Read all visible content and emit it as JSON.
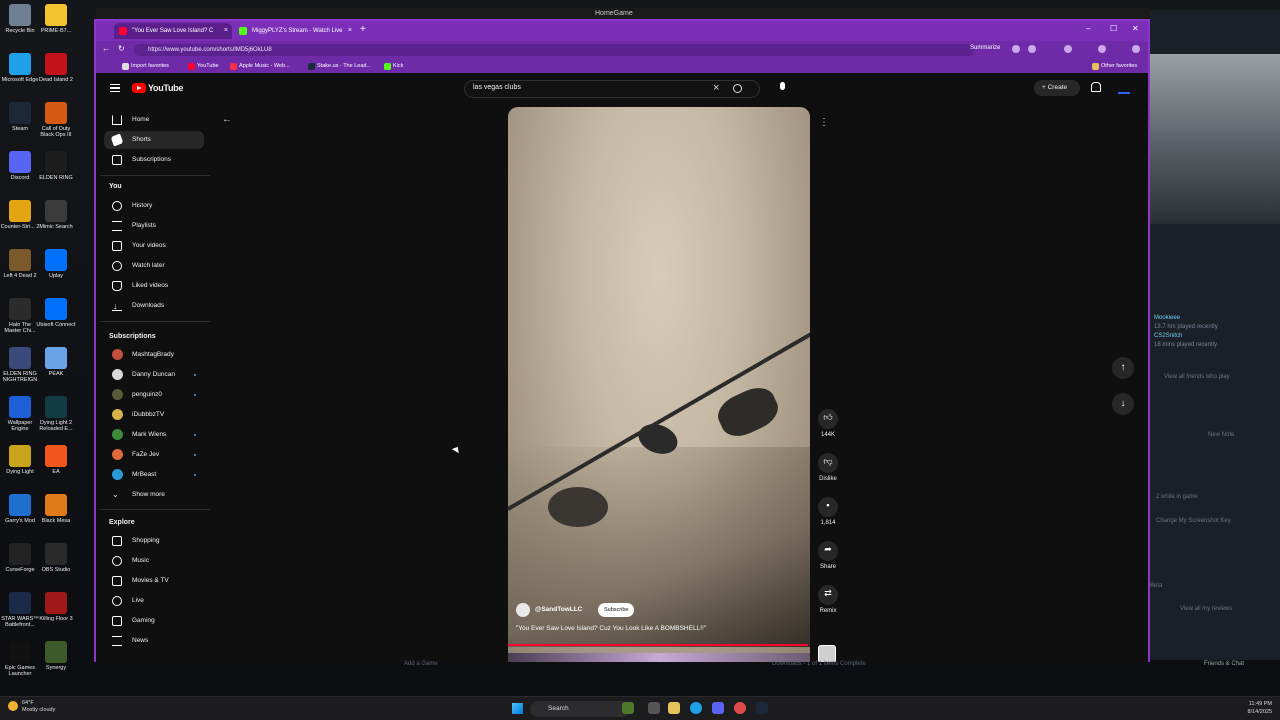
{
  "desktop": {
    "icons_col1": [
      {
        "label": "Recycle Bin",
        "color": "#6f7f93"
      },
      {
        "label": "Microsoft Edge",
        "color": "#1fa0e8"
      },
      {
        "label": "Steam",
        "color": "#1b2838"
      },
      {
        "label": "Discord",
        "color": "#5865f2"
      },
      {
        "label": "Counter-Stri... 2",
        "color": "#e3a512"
      },
      {
        "label": "Left 4 Dead 2",
        "color": "#7a5a2a"
      },
      {
        "label": "Halo The Master Chi...",
        "color": "#2b2b2b"
      },
      {
        "label": "ELDEN RING NIGHTREIGN",
        "color": "#3a4a7a"
      },
      {
        "label": "Wallpaper Engine",
        "color": "#1d5fd6"
      },
      {
        "label": "Dying Light",
        "color": "#c8a31c"
      },
      {
        "label": "Garry's Mod",
        "color": "#1f6fd1"
      },
      {
        "label": "CurseForge",
        "color": "#222222"
      },
      {
        "label": "STAR WARS™ Battlefront...",
        "color": "#1c2a4a"
      },
      {
        "label": "Epic Games Launcher",
        "color": "#111111"
      }
    ],
    "icons_col2": [
      {
        "label": "PRIME-B7...",
        "color": "#f4c430"
      },
      {
        "label": "Dead Island 2",
        "color": "#c4121b"
      },
      {
        "label": "Call of Duty Black Ops III",
        "color": "#d65a12"
      },
      {
        "label": "ELDEN RING",
        "color": "#1d1d1d"
      },
      {
        "label": "Mimic Search",
        "color": "#3b3b3b"
      },
      {
        "label": "Uplay",
        "color": "#0070ff"
      },
      {
        "label": "Ubisoft Connect",
        "color": "#0070ff"
      },
      {
        "label": "PEAK",
        "color": "#6aa4e8"
      },
      {
        "label": "Dying Light 2 Reloaded E...",
        "color": "#123c44"
      },
      {
        "label": "EA",
        "color": "#f2561d"
      },
      {
        "label": "Black Mesa",
        "color": "#e07a1c"
      },
      {
        "label": "OBS Studio",
        "color": "#2a2a2a"
      },
      {
        "label": "Killing Floor 3",
        "color": "#a01818"
      },
      {
        "label": "Synergy",
        "color": "#3d5a2a"
      }
    ]
  },
  "top_strip": {
    "title": "HomeGame"
  },
  "browser": {
    "tabs": [
      {
        "title": "\"You Ever Saw Love Island? C",
        "close": "×",
        "fav_color": "#ff0033"
      },
      {
        "title": "MiggyPLYZ's Stream - Watch Live",
        "close": "×",
        "fav_color": "#53fc18"
      }
    ],
    "new_tab": "+",
    "window_controls": [
      "–",
      "☐",
      "✕"
    ],
    "url": "https://www.youtube.com/shorts/lMD5j6OkLU8",
    "summarize_label": "Summarize",
    "favorites": [
      {
        "label": "Import favorites",
        "color": "#dddddd"
      },
      {
        "label": "YouTube",
        "color": "#ff0033"
      },
      {
        "label": "Apple Music - Web...",
        "color": "#fa2d48"
      },
      {
        "label": "Stake.us - The Lead...",
        "color": "#1a2c38"
      },
      {
        "label": "Kick",
        "color": "#53fc18"
      }
    ],
    "other_favorites": "Other favorites"
  },
  "youtube": {
    "logo_text": "YouTube",
    "search_value": "las vegas clubs",
    "create_label": "+ Create",
    "sidebar": {
      "main": [
        {
          "label": "Home",
          "icon": "home-icon"
        },
        {
          "label": "Shorts",
          "icon": "shorts-icon",
          "selected": true
        },
        {
          "label": "Subscriptions",
          "icon": "subscriptions-icon"
        }
      ],
      "you_header": "You",
      "you_items": [
        {
          "label": "History",
          "icon": "history-icon"
        },
        {
          "label": "Playlists",
          "icon": "playlists-icon"
        },
        {
          "label": "Your videos",
          "icon": "your-videos-icon"
        },
        {
          "label": "Watch later",
          "icon": "watch-later-icon"
        },
        {
          "label": "Liked videos",
          "icon": "liked-videos-icon"
        },
        {
          "label": "Downloads",
          "icon": "downloads-icon"
        }
      ],
      "subs_header": "Subscriptions",
      "subscriptions": [
        {
          "label": "MashtagBrady",
          "color": "#c2503c",
          "live": false
        },
        {
          "label": "Danny Duncan",
          "color": "#d8d8d8",
          "live": true
        },
        {
          "label": "penguinz0",
          "color": "#5a5a3a",
          "live": true
        },
        {
          "label": "iDubbbzTV",
          "color": "#d9b24a",
          "live": false
        },
        {
          "label": "Mark Wiens",
          "color": "#3c8a3c",
          "live": true
        },
        {
          "label": "FaZe Jev",
          "color": "#e06a3a",
          "live": true
        },
        {
          "label": "MrBeast",
          "color": "#2b9bd8",
          "live": true
        }
      ],
      "show_more": "Show more",
      "explore_header": "Explore",
      "explore": [
        {
          "label": "Shopping",
          "icon": "shopping-icon"
        },
        {
          "label": "Music",
          "icon": "music-icon"
        },
        {
          "label": "Movies & TV",
          "icon": "movies-icon"
        },
        {
          "label": "Live",
          "icon": "live-icon"
        },
        {
          "label": "Gaming",
          "icon": "gaming-icon"
        },
        {
          "label": "News",
          "icon": "news-icon"
        }
      ]
    },
    "short": {
      "channel": "@SandTowLLC",
      "subscribe_label": "Subscribe",
      "title": "\"You Ever Saw Love Island? Cuz You Look Like A BOMBSHELL!!\""
    },
    "actions": {
      "likes": "144K",
      "dislike": "Dislike",
      "comments": "1,814",
      "share": "Share",
      "remix": "Remix"
    }
  },
  "bg_app": {
    "friend1_name": "Mookieee",
    "friend1_status": "13.7 hrs played recently",
    "friend2_name": "CS2Snitch",
    "friend2_status": "18 mins played recently",
    "view_friends": "View all friends who play",
    "new_note": "New Note",
    "while_in_game": "2 while in game",
    "change_key": "Change My Screenshot Key",
    "beta": "Beta",
    "view_reviews": "View all my reviews",
    "friends_chat": "Friends & Chat"
  },
  "below_browser": {
    "add_game": "Add a Game",
    "downloads": "Downloads - 1 of 1 Items Complete"
  },
  "taskbar": {
    "weather_temp": "64°F",
    "weather_desc": "Mostly cloudy",
    "search_label": "Search",
    "time": "11:49 PM",
    "date": "8/14/2025"
  }
}
